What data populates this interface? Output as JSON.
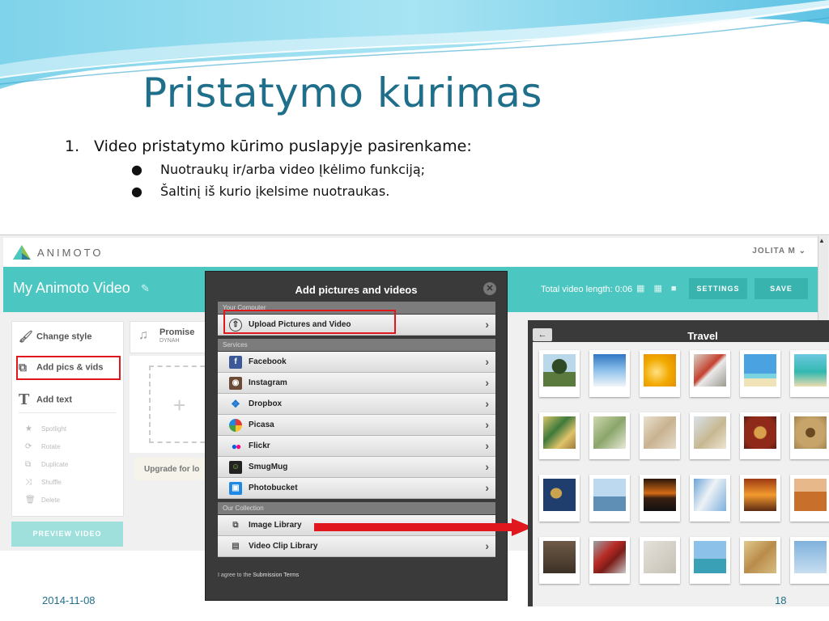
{
  "slide": {
    "title": "Pristatymo kūrimas",
    "item_number": "1.",
    "item_text": "Video pristatymo kūrimo puslapyje pasirenkame:",
    "sub_bullets": [
      "Nuotraukų ir/arba video Įkėlimo funkciją;",
      "Šaltinį iš kurio įkelsime nuotraukas."
    ],
    "footer_date": "2014-11-08",
    "footer_page": "18"
  },
  "animoto": {
    "logo_text": "ANIMOTO",
    "user": "JOLITA M",
    "video_title": "My Animoto Video",
    "video_length": "Total video length: 0:06",
    "settings_label": "SETTINGS",
    "save_label": "SAVE",
    "left_menu": [
      "Change style",
      "Add pics & vids",
      "Add text"
    ],
    "left_small": [
      "Spotlight",
      "Rotate",
      "Duplicate",
      "Shuffle",
      "Delete"
    ],
    "preview_label": "PREVIEW VIDEO",
    "song_name": "Promise",
    "song_sub": "DYNAH",
    "upgrade_text": "Upgrade for lo",
    "drop_plus": "+"
  },
  "modal": {
    "title": "Add pictures and videos",
    "close": "✕",
    "sections": {
      "computer": "Your Computer",
      "services": "Services",
      "collection": "Our Collection"
    },
    "upload_label": "Upload Pictures and Video",
    "services": [
      "Facebook",
      "Instagram",
      "Dropbox",
      "Picasa",
      "Flickr",
      "SmugMug",
      "Photobucket"
    ],
    "collection": [
      "Image Library",
      "Video Clip Library"
    ],
    "agree_prefix": "I agree to the",
    "agree_link": "Submission Terms"
  },
  "travel": {
    "back": "←",
    "title": "Travel"
  },
  "colors": {
    "teal": "#4cc6c0",
    "title_blue": "#1f6f8b",
    "highlight_red": "#e0171c"
  }
}
